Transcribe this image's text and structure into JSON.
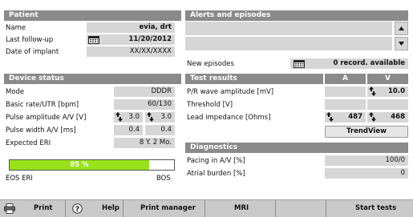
{
  "patient": {
    "header": "Patient",
    "name_label": "Name",
    "name_value": "evia, drt",
    "last_followup_label": "Last follow-up",
    "last_followup_value": "11/20/2012",
    "implant_label": "Date of implant",
    "implant_value": "XX/XX/XXXX"
  },
  "alerts": {
    "header": "Alerts and episodes",
    "new_episodes_label": "New episodes",
    "new_episodes_value": "0 record. available"
  },
  "device": {
    "header": "Device status",
    "mode_label": "Mode",
    "mode_value": "DDDR",
    "rate_label": "Basic rate/UTR [bpm]",
    "rate_value": "60/130",
    "pulse_amp_label": "Pulse amplitude A/V [V]",
    "pulse_amp_a": "3.0",
    "pulse_amp_v": "3.0",
    "pulse_width_label": "Pulse width A/V [ms]",
    "pulse_width_a": "0.4",
    "pulse_width_v": "0.4",
    "eri_label": "Expected ERI",
    "eri_value": "8 Y. 2 Mo.",
    "battery_percent_text": "85 %",
    "battery_level": 0.85,
    "battery_left_label": "EOS ERI",
    "battery_right_label": "BOS"
  },
  "tests": {
    "header": "Test results",
    "col_a": "A",
    "col_v": "V",
    "pwave_label": "P/R wave amplitude [mV]",
    "pwave_v": "10.0",
    "threshold_label": "Threshold [V]",
    "impedance_label": "Lead impedance [Ohms]",
    "impedance_a": "487",
    "impedance_v": "468",
    "trendview_label": "TrendView"
  },
  "diagnostics": {
    "header": "Diagnostics",
    "pacing_label": "Pacing in A/V [%]",
    "pacing_value": "100/0",
    "atrial_label": "Atrial burden [%]",
    "atrial_value": "0"
  },
  "toolbar": {
    "print": "Print",
    "help": "Help",
    "print_manager": "Print manager",
    "mri": "MRI",
    "start_tests": "Start tests"
  },
  "icons": {
    "calendar": "calendar-icon",
    "update": "update-arrows-icon",
    "printer": "printer-icon",
    "help": "help-icon",
    "scroll_up": "scroll-up-icon",
    "scroll_down": "scroll-down-icon"
  },
  "colors": {
    "battery_fill": "#99e21a",
    "header_bg": "#8a8a8a"
  }
}
